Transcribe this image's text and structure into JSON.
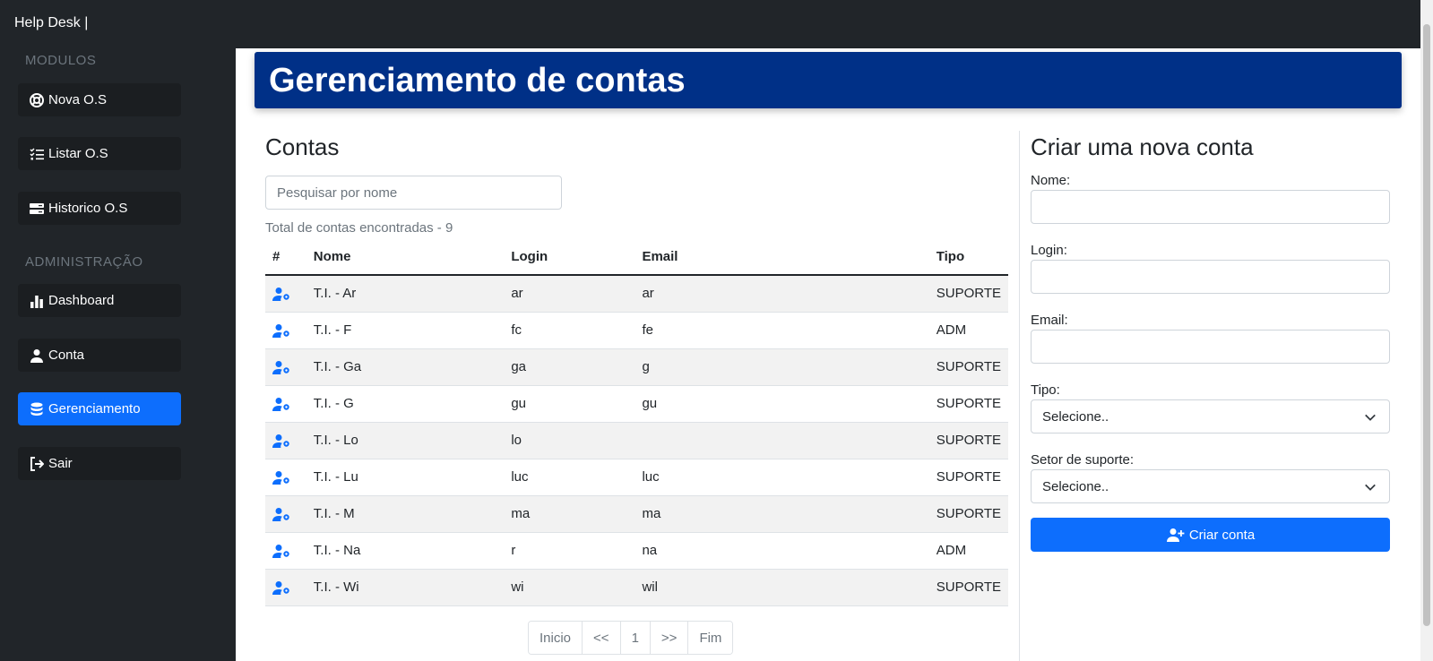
{
  "app": {
    "brand": "Help Desk |"
  },
  "sidebar": {
    "modulos_heading": "MODULOS",
    "admin_heading": "ADMINISTRAÇÃO",
    "items": [
      {
        "label": "Nova O.S",
        "icon": "lifebuoy-icon"
      },
      {
        "label": "Listar O.S",
        "icon": "list-check-icon"
      },
      {
        "label": "Historico O.S",
        "icon": "history-icon"
      },
      {
        "label": "Dashboard",
        "icon": "bar-chart-icon"
      },
      {
        "label": "Conta",
        "icon": "person-icon"
      },
      {
        "label": "Gerenciamento",
        "icon": "database-icon",
        "active": true
      },
      {
        "label": "Sair",
        "icon": "logout-icon"
      }
    ]
  },
  "header": {
    "title": "Gerenciamento de contas"
  },
  "accounts": {
    "title": "Contas",
    "search_placeholder": "Pesquisar por nome",
    "total_text": "Total de contas encontradas - 9",
    "columns": [
      "#",
      "Nome",
      "Login",
      "Email",
      "Tipo"
    ],
    "rows": [
      {
        "nome": "T.I. - Ar",
        "login": "ar",
        "email": "ar",
        "tipo": "SUPORTE"
      },
      {
        "nome": "T.I. - F",
        "login": "fc",
        "email": "fe",
        "tipo": "ADM"
      },
      {
        "nome": "T.I. - Ga",
        "login": "ga",
        "email": "g",
        "tipo": "SUPORTE"
      },
      {
        "nome": "T.I. - G",
        "login": "gu",
        "email": "gu",
        "tipo": "SUPORTE"
      },
      {
        "nome": "T.I. - Lo",
        "login": "lo",
        "email": "",
        "tipo": "SUPORTE"
      },
      {
        "nome": "T.I. - Lu",
        "login": "luc",
        "email": "luc",
        "tipo": "SUPORTE"
      },
      {
        "nome": "T.I. - M",
        "login": "ma",
        "email": "ma",
        "tipo": "SUPORTE"
      },
      {
        "nome": "T.I. - Na",
        "login": "r",
        "email": "na",
        "tipo": "ADM"
      },
      {
        "nome": "T.I. - Wi",
        "login": "wi",
        "email": "wil",
        "tipo": "SUPORTE"
      }
    ],
    "pagination": [
      "Inicio",
      "<<",
      "1",
      ">>",
      "Fim"
    ]
  },
  "form": {
    "title": "Criar uma nova conta",
    "nome_label": "Nome:",
    "login_label": "Login:",
    "email_label": "Email:",
    "tipo_label": "Tipo:",
    "tipo_value": "Selecione..",
    "setor_label": "Setor de suporte:",
    "setor_value": "Selecione..",
    "submit_label": "Criar conta"
  },
  "colors": {
    "primary": "#0d6efd",
    "banner": "#003087",
    "sidebar": "#212529"
  }
}
